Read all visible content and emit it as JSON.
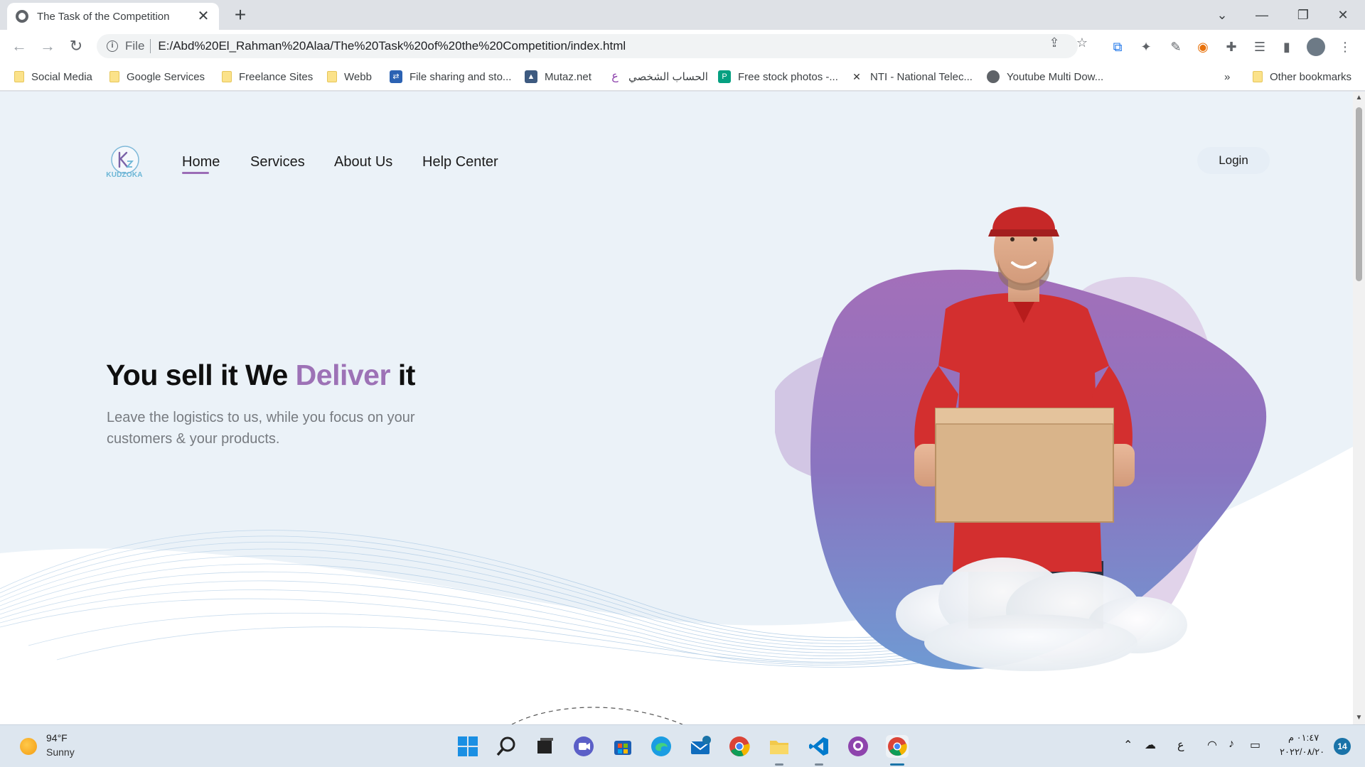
{
  "browser": {
    "tab_title": "The Task of the Competition",
    "tab_close": "✕",
    "new_tab": "+",
    "window_controls": {
      "dropdown": "⌄",
      "minimize": "—",
      "restore": "❐",
      "close": "✕"
    },
    "nav": {
      "back": "←",
      "forward": "→",
      "reload": "↻"
    },
    "address": {
      "scheme": "File",
      "url": "E:/Abd%20El_Rahman%20Alaa/The%20Task%20of%20the%20Competition/index.html"
    },
    "bookmarks": [
      {
        "label": "Social Media",
        "kind": "folder"
      },
      {
        "label": "Google Services",
        "kind": "folder"
      },
      {
        "label": "Freelance Sites",
        "kind": "folder"
      },
      {
        "label": "Webb",
        "kind": "folder"
      },
      {
        "label": "File sharing and sto...",
        "kind": "site"
      },
      {
        "label": "Mutaz.net",
        "kind": "site"
      },
      {
        "label": "الحساب الشخصي",
        "kind": "site"
      },
      {
        "label": "Free stock photos -...",
        "kind": "site"
      },
      {
        "label": "NTI - National Telec...",
        "kind": "site"
      },
      {
        "label": "Youtube Multi Dow...",
        "kind": "site"
      }
    ],
    "bookmarks_more": "»",
    "other_bookmarks": "Other bookmarks"
  },
  "page": {
    "logo_text": "KUDZOKA",
    "nav": [
      "Home",
      "Services",
      "About Us",
      "Help Center"
    ],
    "login": "Login",
    "hero": {
      "title_part1": "You sell it We ",
      "title_accent": "Deliver",
      "title_part2": " it",
      "subtitle": "Leave the logistics to us, while you focus on your customers & your products."
    },
    "colors": {
      "accent": "#9d72b6",
      "background": "#ebf2f8",
      "blob_top": "#9b6cb6",
      "blob_bottom": "#6f9ad3"
    }
  },
  "taskbar": {
    "weather_temp": "94°F",
    "weather_desc": "Sunny",
    "input_lang": "ع",
    "clock_time": "٠١:٤٧ م",
    "clock_date": "٢٠٢٢/٠٨/٢٠",
    "notifications": "14",
    "apps": [
      "windows-start-icon",
      "search-icon",
      "task-view-icon",
      "meet-icon",
      "store-icon",
      "edge-icon",
      "mail-icon",
      "chrome-icon",
      "file-explorer-icon",
      "vscode-icon",
      "github-icon",
      "chrome-active-icon"
    ]
  }
}
